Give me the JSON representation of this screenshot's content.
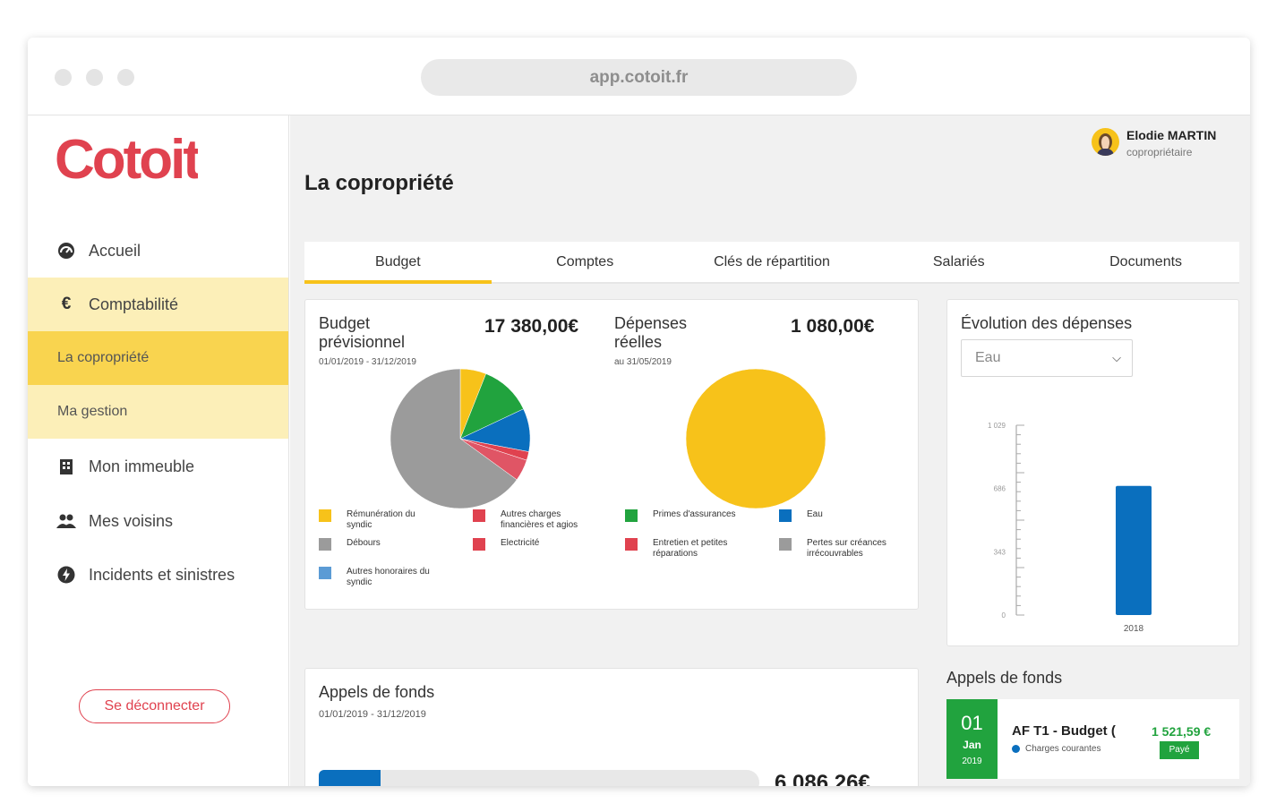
{
  "browser": {
    "url": "app.cotoit.fr"
  },
  "brand": {
    "logo_text": "Cotoit",
    "primary_color": "#e0424f",
    "accent_color": "#f7c21a"
  },
  "sidebar": {
    "items": [
      {
        "label": "Accueil",
        "icon": "dashboard-icon"
      },
      {
        "label": "Comptabilité",
        "icon": "euro-icon"
      },
      {
        "label": "La copropriété",
        "active": true
      },
      {
        "label": "Ma gestion"
      },
      {
        "label": "Mon immeuble",
        "icon": "building-icon"
      },
      {
        "label": "Mes voisins",
        "icon": "people-icon"
      },
      {
        "label": "Incidents et sinistres",
        "icon": "bolt-icon"
      }
    ],
    "logout_label": "Se déconnecter"
  },
  "user": {
    "name": "Elodie MARTIN",
    "role": "copropriétaire"
  },
  "page": {
    "title": "La copropriété"
  },
  "tabs": [
    "Budget",
    "Comptes",
    "Clés de répartition",
    "Salariés",
    "Documents"
  ],
  "budget": {
    "title": "Budget prévisionnel",
    "title_line1": "Budget",
    "title_line2": "prévisionnel",
    "period": "01/01/2019 - 31/12/2019",
    "amount": "17 380,00€",
    "legend": [
      {
        "label_line1": "Rémunération du",
        "label_line2": "syndic",
        "color": "#f7c21a"
      },
      {
        "label_line1": "Autres charges",
        "label_line2": "financières et agios",
        "color": "#e0424f"
      },
      {
        "label_line1": "Débours",
        "label_line2": "",
        "color": "#9b9b9b"
      },
      {
        "label_line1": "Electricité",
        "label_line2": "",
        "color": "#e0424f"
      },
      {
        "label_line1": "Autres honoraires du",
        "label_line2": "syndic",
        "color": "#5b9bd5"
      }
    ]
  },
  "depenses": {
    "title_line1": "Dépenses",
    "title_line2": "réelles",
    "period": "au 31/05/2019",
    "amount": "1 080,00€",
    "legend": [
      {
        "label_line1": "Primes d'assurances",
        "label_line2": "",
        "color": "#21a33e"
      },
      {
        "label_line1": "Eau",
        "label_line2": "",
        "color": "#0a6fbe"
      },
      {
        "label_line1": "Entretien et petites",
        "label_line2": "réparations",
        "color": "#e0424f"
      },
      {
        "label_line1": "Pertes sur créances",
        "label_line2": "irrécouvrables",
        "color": "#9b9b9b"
      }
    ]
  },
  "evolution": {
    "title": "Évolution des dépenses",
    "select_value": "Eau"
  },
  "appels_main": {
    "title": "Appels de fonds",
    "period": "01/01/2019 - 31/12/2019",
    "amount": "6 086,26€",
    "progress": 0.14
  },
  "appels_side": {
    "title": "Appels de fonds",
    "item": {
      "day": "01",
      "month": "Jan",
      "year": "2019",
      "name": "AF T1 - Budget (",
      "category": "Charges courantes",
      "amount": "1 521,59 €",
      "status": "Payé"
    }
  },
  "chart_data": [
    {
      "type": "pie",
      "categories": [
        "Rémunération du syndic",
        "Primes d'assurances",
        "Eau",
        "Entretien et petites réparations",
        "Electricité",
        "Débours"
      ],
      "values": [
        6,
        12,
        10,
        2,
        5,
        65
      ],
      "colors": [
        "#f7c21a",
        "#21a33e",
        "#0a6fbe",
        "#e0424f",
        "#e05565",
        "#9b9b9b"
      ]
    },
    {
      "type": "pie",
      "categories": [
        "Eau"
      ],
      "values": [
        100
      ],
      "colors": [
        "#f7c21a"
      ]
    },
    {
      "type": "bar",
      "categories": [
        "2018"
      ],
      "values": [
        700
      ],
      "yticks": [
        "0",
        "343",
        "686",
        "1 029"
      ],
      "ylim": [
        0,
        1029
      ],
      "color": "#0a6fbe"
    }
  ]
}
